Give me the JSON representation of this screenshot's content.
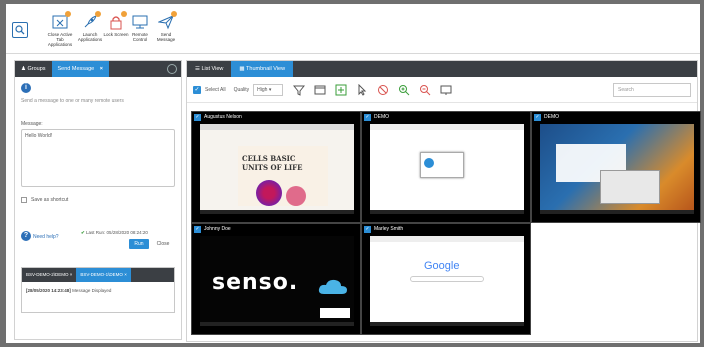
{
  "toolbar": {
    "buttons": [
      {
        "label": "Close Active Tab Applications",
        "icon": "close-window-icon"
      },
      {
        "label": "Launch Applications",
        "icon": "rocket-icon"
      },
      {
        "label": "Lock Screen",
        "icon": "lock-icon"
      },
      {
        "label": "Remote Control",
        "icon": "monitor-icon"
      },
      {
        "label": "Send Message",
        "icon": "paper-plane-icon"
      }
    ]
  },
  "left": {
    "tabs": [
      {
        "label": "Groups"
      },
      {
        "label": "Send Message",
        "close": "×"
      }
    ],
    "info_text": "Send a message to one or many remote users",
    "message_label": "Message:",
    "message_value": "Hello World!",
    "save_shortcut_label": "Save as shortcut",
    "need_help": "Need help?",
    "last_run": "Last Run: 05/28/2020 08:24:20",
    "run_label": "Run",
    "close_label": "Close",
    "result_tabs": [
      {
        "label": "BSV-DEMO-2\\DEMO",
        "close": "×"
      },
      {
        "label": "BSV-DEMO-1\\DEMO",
        "close": "×"
      }
    ],
    "result_time": "[28/05/2020 14:23:48]",
    "result_msg": "Message Displayed"
  },
  "right": {
    "tabs": [
      {
        "label": "List View"
      },
      {
        "label": "Thumbnail View"
      }
    ],
    "select_all": "Select All",
    "quality_label": "Quality",
    "quality_value": "High",
    "search_placeholder": "Search",
    "tiles": [
      {
        "name": "Augustus Nelson",
        "content": "CELLS BASIC UNITS OF LIFE"
      },
      {
        "name": "DEMO",
        "content": ""
      },
      {
        "name": "DEMO",
        "content": ""
      },
      {
        "name": "Johnny Doe",
        "content": "senso."
      },
      {
        "name": "Marley Smith",
        "content": "Google"
      }
    ]
  },
  "colors": {
    "accent": "#2c8ed6",
    "dark_tab": "#3b3f44",
    "badge": "#f0a13a"
  }
}
